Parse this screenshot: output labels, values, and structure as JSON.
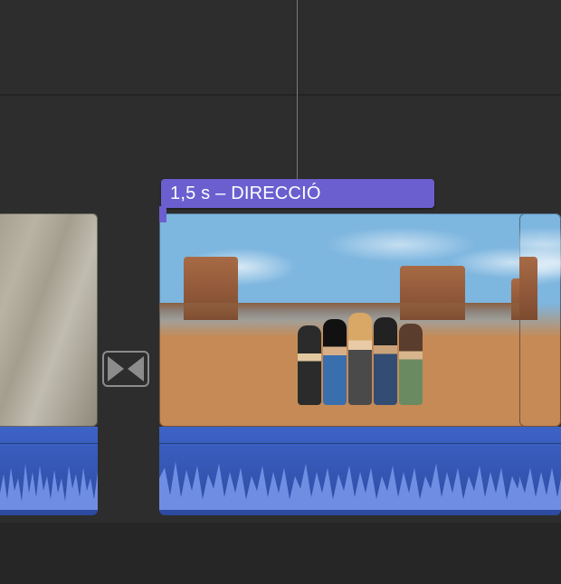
{
  "title_overlay": {
    "label": "1,5 s – DIRECCIÓ"
  },
  "colors": {
    "title_bg": "#6b5fd0",
    "audio_bg_top": "#3d63c7",
    "audio_bg_bottom": "#2d4aa0",
    "waveform": "#6f8ee3",
    "app_bg": "#2d2d2d"
  },
  "transition": {
    "icon": "crossfade-transition"
  }
}
